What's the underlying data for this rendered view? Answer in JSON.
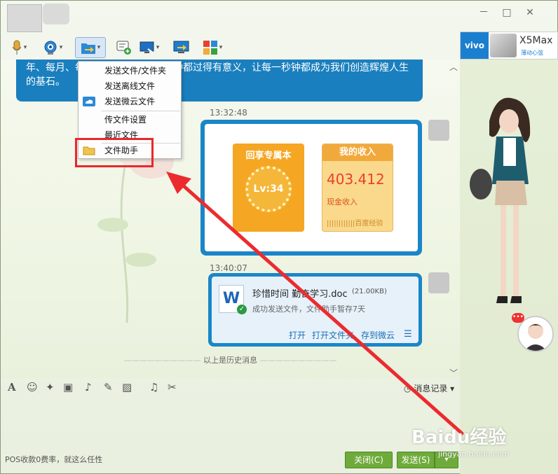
{
  "window": {
    "controls": {
      "minimize": "－",
      "maximize": "□",
      "close": "✕"
    }
  },
  "toolbar": {
    "icons": [
      "microphone-icon",
      "webcam-icon",
      "transfer-file-icon",
      "add-chat-icon",
      "remote-desktop-icon",
      "share-screen-icon",
      "apps-icon"
    ],
    "dropdown_arrow": "▾"
  },
  "file_menu": {
    "items": [
      "发送文件/文件夹",
      "发送离线文件",
      "发送微云文件",
      "传文件设置",
      "最近文件",
      "文件助手"
    ]
  },
  "chat": {
    "previous_message": "年、每月、每天、每小时、每一分钟都过得有意义，让每一秒钟都成为我们创造辉煌人生的基石。",
    "timestamp1": "13:32:48",
    "card": {
      "tile1_title": "回享专属本",
      "level": "Lv:34",
      "tile2_title": "我的收入",
      "income": "403.412",
      "income_label": "现金收入",
      "footer": "||||||||||||百度经验"
    },
    "timestamp2": "13:40:07",
    "file": {
      "name": "珍惜时间 勤奋学习.doc",
      "size": "(21.00KB)",
      "status": "成功发送文件，文件助手暂存7天",
      "doc_letter": "W",
      "actions": [
        "打开",
        "打开文件夹",
        "存到微云"
      ]
    },
    "history_label": "以上是历史消息"
  },
  "input_toolbar": {
    "icons": [
      "font-icon",
      "emoji-icon",
      "magic-icon",
      "video-clip-icon",
      "voice-icon",
      "edit-icon",
      "image-icon",
      "music-icon",
      "scissors-icon"
    ],
    "message_record": "消息记录"
  },
  "footer": {
    "ad_text": "POS收款0费率，就这么任性",
    "close_label": "关闭(C)",
    "send_label": "发送(S)",
    "send_dropdown": "▾"
  },
  "right_panel": {
    "ad_brand": "vivo",
    "ad_model": "X5Max",
    "ad_slogan": "薄动心弦"
  },
  "watermark": {
    "text": "Baidu经验",
    "sub": "jingyan.baidu.com"
  },
  "colors": {
    "accent_blue": "#1a86c8",
    "highlight_red": "#e8282b",
    "button_green": "#6fab3a",
    "income_red": "#e8412c"
  }
}
